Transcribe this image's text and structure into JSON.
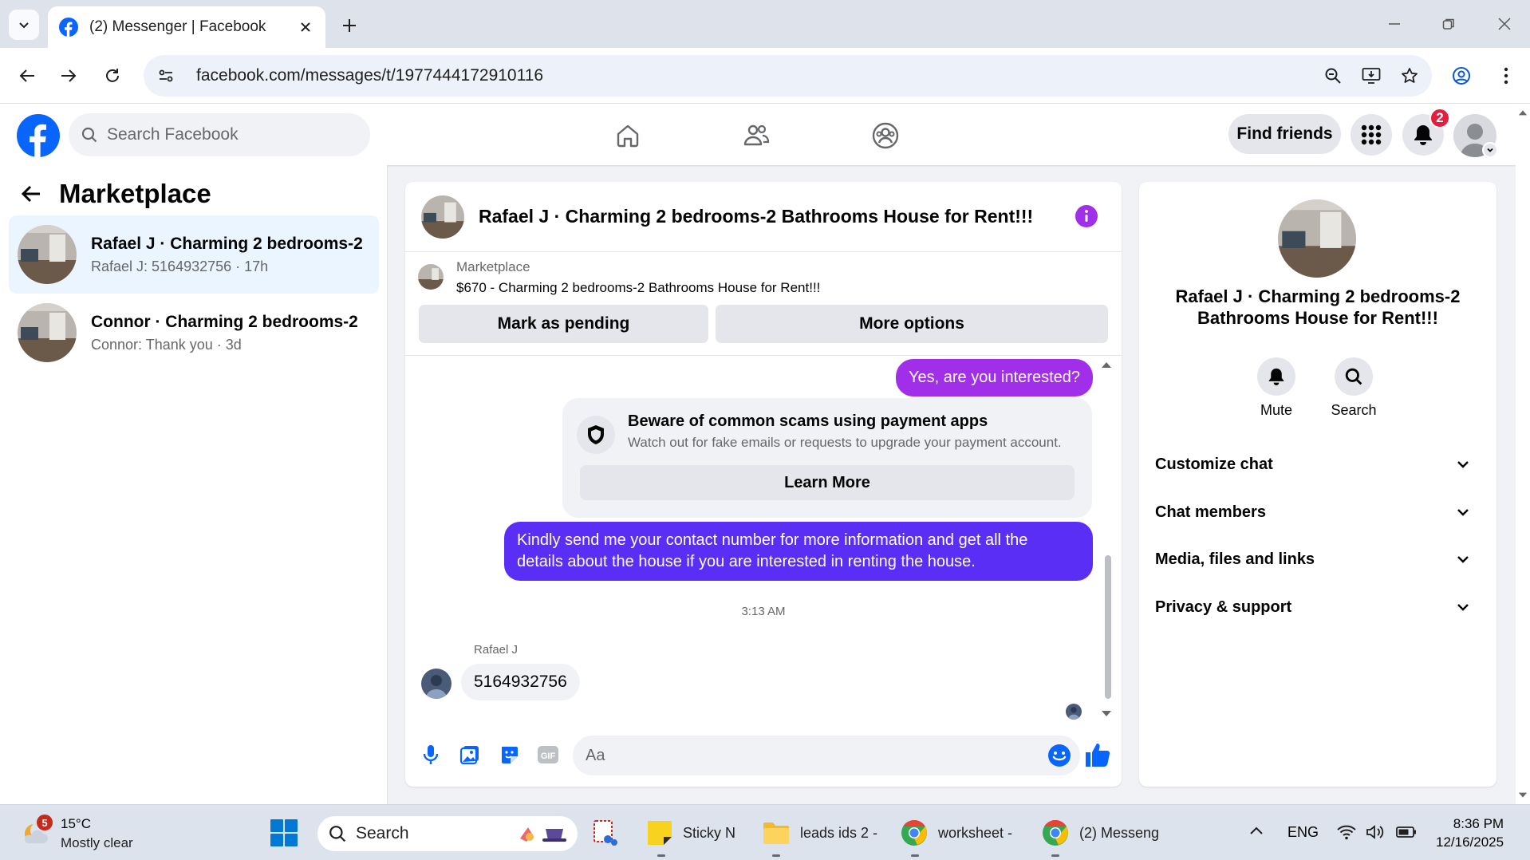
{
  "browser": {
    "tab_title": "(2) Messenger | Facebook",
    "url": "facebook.com/messages/t/1977444172910116"
  },
  "fb_header": {
    "search_placeholder": "Search Facebook",
    "find_friends_label": "Find friends",
    "notification_count": "2"
  },
  "sidebar": {
    "title": "Marketplace",
    "conversations": [
      {
        "name": "Rafael J · Charming 2 bedrooms-2 ...",
        "preview": "Rafael J: 5164932756 · 17h",
        "active": true
      },
      {
        "name": "Connor · Charming 2 bedrooms-2 ...",
        "preview": "Connor: Thank you · 3d",
        "active": false
      }
    ]
  },
  "chat": {
    "title": "Rafael J · Charming 2 bedrooms-2 Bathrooms House for Rent!!!",
    "marketplace_label": "Marketplace",
    "listing": "$670 - Charming 2 bedrooms-2 Bathrooms House for Rent!!!",
    "mark_pending_label": "Mark as pending",
    "more_options_label": "More options",
    "messages": {
      "outgoing_1": "Yes, are you interested?",
      "scam_title": "Beware of common scams using payment apps",
      "scam_text": "Watch out for fake emails or requests to upgrade your payment account.",
      "learn_more_label": "Learn More",
      "outgoing_2_line1": "Kindly send me your contact number for more information and get all the",
      "outgoing_2_line2": "details about the house if you are interested in renting the house.",
      "timestamp": "3:13 AM",
      "sender_name": "Rafael J",
      "incoming_1": "5164932756"
    },
    "composer_placeholder": "Aa",
    "colors": {
      "bubble_purple": "#a12ee8",
      "bubble_indigo": "#5b2ef5",
      "fb_blue": "#0866ff"
    }
  },
  "info_panel": {
    "name": "Rafael J · Charming 2 bedrooms-2 Bathrooms House for Rent!!!",
    "mute_label": "Mute",
    "search_label": "Search",
    "sections": [
      "Customize chat",
      "Chat members",
      "Media, files and links",
      "Privacy & support"
    ]
  },
  "taskbar": {
    "weather_badge": "5",
    "temperature": "15°C",
    "weather": "Mostly clear",
    "search_placeholder": "Search",
    "apps": [
      "Sticky N",
      "leads ids 2 -",
      "worksheet -",
      "(2) Messeng"
    ],
    "language": "ENG",
    "time": "8:36 PM",
    "date": "12/16/2025"
  }
}
